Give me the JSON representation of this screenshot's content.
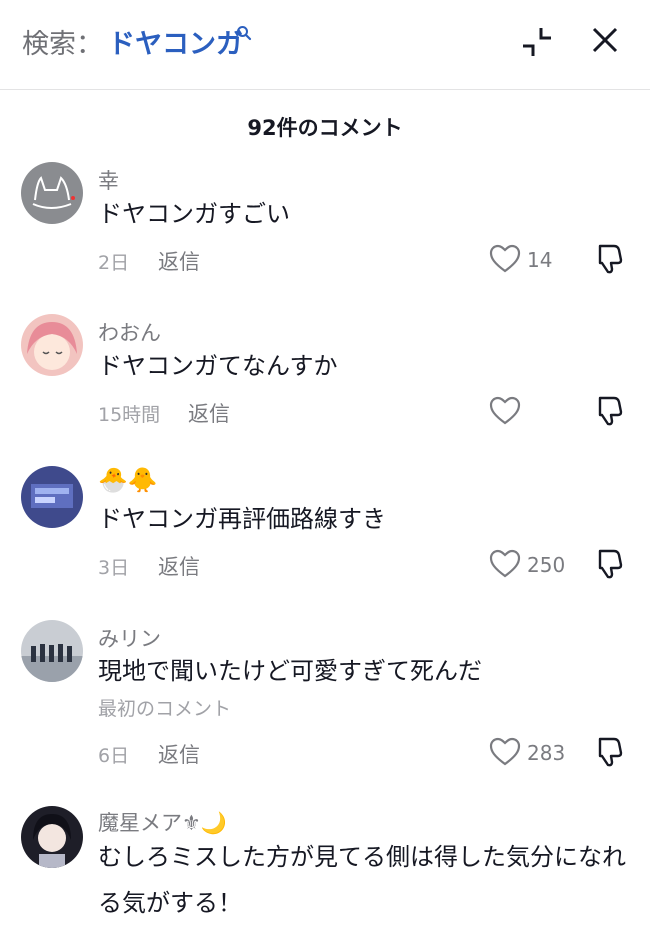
{
  "header": {
    "search_label": "検索：",
    "search_term": "ドヤコンガ",
    "icons": [
      "search-icon",
      "collapse-icon",
      "close-icon"
    ]
  },
  "comment_count": "92件のコメント",
  "reply_label": "返信",
  "comments": [
    {
      "username": "幸",
      "text": "ドヤコンガすごい",
      "time": "2日",
      "likes": "14"
    },
    {
      "username": "わおん",
      "text": "ドヤコンガてなんすか",
      "time": "15時間",
      "likes": ""
    },
    {
      "username": "🐣🐥",
      "text": "ドヤコンガ再評価路線すき",
      "time": "3日",
      "likes": "250"
    },
    {
      "username": "みリン",
      "text": "現地で聞いたけど可愛すぎて死んだ",
      "tag": "最初のコメント",
      "time": "6日",
      "likes": "283"
    },
    {
      "username": "魔星メア⚜🌙",
      "text": "むしろミスした方が見てる側は得した気分になれる気がする！"
    }
  ]
}
